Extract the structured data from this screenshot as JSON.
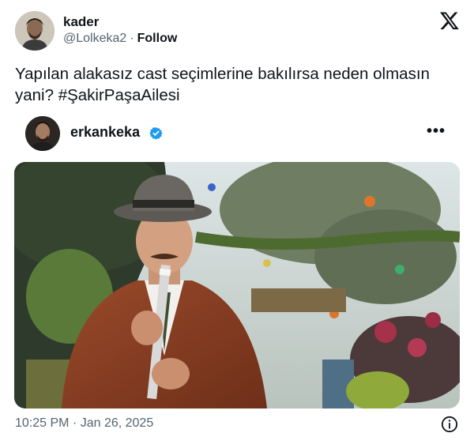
{
  "author": {
    "name": "kader",
    "handle": "@Lolkeka2",
    "separator": "·",
    "follow_label": "Follow"
  },
  "tweet": {
    "text": "Yapılan alakasız cast seçimlerine bakılırsa neden olmasın yani? #ŞakirPaşaAilesi",
    "timestamp": "10:25 PM · Jan 26, 2025"
  },
  "embedded_post": {
    "username": "erkankeka",
    "verified": true,
    "more_label": "•••"
  },
  "icons": {
    "platform_logo": "x-logo-icon",
    "verified": "verified-badge-icon",
    "more": "more-options-icon",
    "info": "info-icon"
  },
  "colors": {
    "verified_blue": "#1d9bf0",
    "secondary_text": "#536471"
  }
}
